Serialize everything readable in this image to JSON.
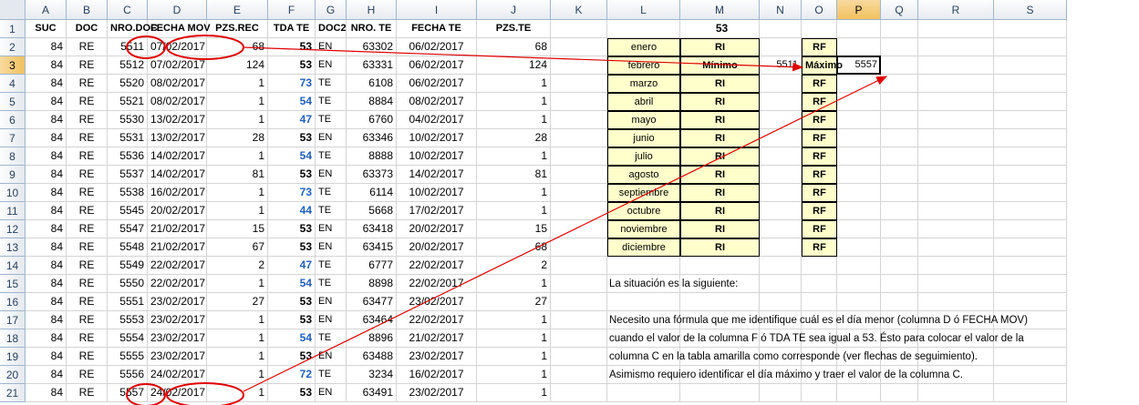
{
  "columns": [
    "A",
    "B",
    "C",
    "D",
    "E",
    "F",
    "G",
    "H",
    "I",
    "J",
    "K",
    "L",
    "M",
    "N",
    "O",
    "P",
    "Q",
    "R",
    "S"
  ],
  "rows": [
    "1",
    "2",
    "3",
    "4",
    "5",
    "6",
    "7",
    "8",
    "9",
    "10",
    "11",
    "12",
    "13",
    "14",
    "15",
    "16",
    "17",
    "18",
    "19",
    "20",
    "21"
  ],
  "headers": [
    "SUC",
    "DOC",
    "NRO.DOC",
    "FECHA MOV",
    "PZS.REC",
    "TDA TE",
    "DOC2",
    "NRO. TE",
    "FECHA TE",
    "PZS.TE"
  ],
  "data": [
    [
      "84",
      "RE",
      "5511",
      "07/02/2017",
      "68",
      "53",
      "EN",
      "63302",
      "06/02/2017",
      "68"
    ],
    [
      "84",
      "RE",
      "5512",
      "07/02/2017",
      "124",
      "53",
      "EN",
      "63331",
      "06/02/2017",
      "124"
    ],
    [
      "84",
      "RE",
      "5520",
      "08/02/2017",
      "1",
      "73",
      "TE",
      "6108",
      "06/02/2017",
      "1"
    ],
    [
      "84",
      "RE",
      "5521",
      "08/02/2017",
      "1",
      "54",
      "TE",
      "8884",
      "08/02/2017",
      "1"
    ],
    [
      "84",
      "RE",
      "5530",
      "13/02/2017",
      "1",
      "47",
      "TE",
      "6760",
      "04/02/2017",
      "1"
    ],
    [
      "84",
      "RE",
      "5531",
      "13/02/2017",
      "28",
      "53",
      "EN",
      "63346",
      "10/02/2017",
      "28"
    ],
    [
      "84",
      "RE",
      "5536",
      "14/02/2017",
      "1",
      "54",
      "TE",
      "8888",
      "10/02/2017",
      "1"
    ],
    [
      "84",
      "RE",
      "5537",
      "14/02/2017",
      "81",
      "53",
      "EN",
      "63373",
      "14/02/2017",
      "81"
    ],
    [
      "84",
      "RE",
      "5538",
      "16/02/2017",
      "1",
      "73",
      "TE",
      "6114",
      "10/02/2017",
      "1"
    ],
    [
      "84",
      "RE",
      "5545",
      "20/02/2017",
      "1",
      "44",
      "TE",
      "5668",
      "17/02/2017",
      "1"
    ],
    [
      "84",
      "RE",
      "5547",
      "21/02/2017",
      "15",
      "53",
      "EN",
      "63418",
      "20/02/2017",
      "15"
    ],
    [
      "84",
      "RE",
      "5548",
      "21/02/2017",
      "67",
      "53",
      "EN",
      "63415",
      "20/02/2017",
      "68"
    ],
    [
      "84",
      "RE",
      "5549",
      "22/02/2017",
      "2",
      "47",
      "TE",
      "6777",
      "22/02/2017",
      "2"
    ],
    [
      "84",
      "RE",
      "5550",
      "22/02/2017",
      "1",
      "54",
      "TE",
      "8898",
      "22/02/2017",
      "1"
    ],
    [
      "84",
      "RE",
      "5551",
      "23/02/2017",
      "27",
      "53",
      "EN",
      "63477",
      "23/02/2017",
      "27"
    ],
    [
      "84",
      "RE",
      "5553",
      "23/02/2017",
      "1",
      "53",
      "EN",
      "63464",
      "22/02/2017",
      "1"
    ],
    [
      "84",
      "RE",
      "5554",
      "23/02/2017",
      "1",
      "54",
      "TE",
      "8896",
      "21/02/2017",
      "1"
    ],
    [
      "84",
      "RE",
      "5555",
      "23/02/2017",
      "1",
      "53",
      "EN",
      "63488",
      "23/02/2017",
      "1"
    ],
    [
      "84",
      "RE",
      "5556",
      "24/02/2017",
      "1",
      "72",
      "TE",
      "3234",
      "16/02/2017",
      "1"
    ],
    [
      "84",
      "RE",
      "5557",
      "24/02/2017",
      "1",
      "53",
      "EN",
      "63491",
      "23/02/2017",
      "1"
    ]
  ],
  "summary": {
    "title": "53",
    "months": [
      "enero",
      "febrero",
      "marzo",
      "abril",
      "mayo",
      "junio",
      "julio",
      "agosto",
      "septiembre",
      "octubre",
      "noviembre",
      "diciembre"
    ],
    "ri_label": "RI",
    "rf_label": "RF",
    "min_label": "Mínimo",
    "max_label": "Máximo",
    "min_value": "5511",
    "max_value": "5557"
  },
  "notes": [
    "La situación es la siguiente:",
    "Necesito una fórmula que me identifique cuál es el día menor (columna D ó FECHA MOV)",
    "cuando el valor de la columna F ó TDA TE sea igual a 53. Ésto para colocar el valor de la",
    "columna C en la tabla amarilla como corresponde (ver flechas de seguimiento).",
    "Asimismo requiero identificar el día máximo y traer el valor de la columna C."
  ],
  "colors": {
    "annotation_red": "#e00000",
    "table_yellow": "#ffffcc",
    "header_blue": "#27415f"
  }
}
